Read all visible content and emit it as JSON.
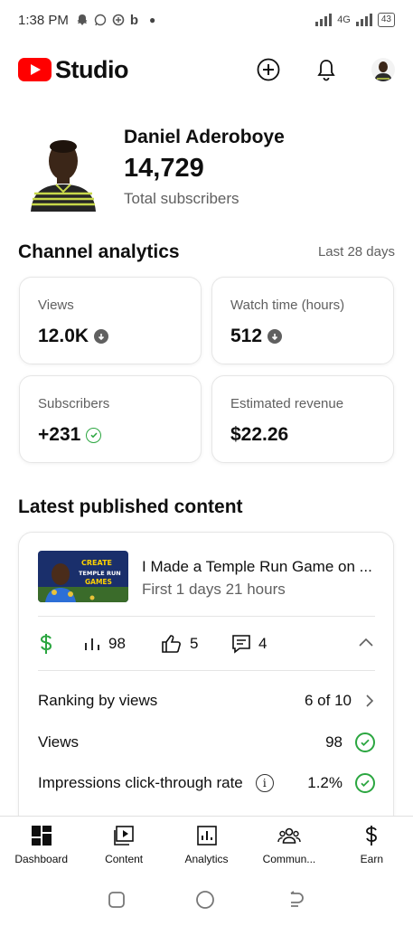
{
  "status_bar": {
    "time": "1:38 PM",
    "network": "4G",
    "battery": "43"
  },
  "app": {
    "logo_text": "Studio",
    "brand_color": "#ff0000"
  },
  "profile": {
    "name": "Daniel Aderoboye",
    "subscriber_count": "14,729",
    "subscriber_label": "Total subscribers"
  },
  "analytics": {
    "title": "Channel analytics",
    "range": "Last 28 days",
    "cards": [
      {
        "label": "Views",
        "value": "12.0K",
        "indicator": "down"
      },
      {
        "label": "Watch time (hours)",
        "value": "512",
        "indicator": "down"
      },
      {
        "label": "Subscribers",
        "value": "+231",
        "indicator": "check"
      },
      {
        "label": "Estimated revenue",
        "value": "$22.26",
        "indicator": "none"
      }
    ]
  },
  "latest": {
    "title": "Latest published content",
    "video_title": "I Made a Temple Run Game on ...",
    "video_age": "First 1 days 21 hours",
    "thumbnail_text": [
      "CREATE",
      "TEMPLE RUN",
      "GAMES"
    ],
    "stats": {
      "views": "98",
      "likes": "5",
      "comments": "4"
    },
    "details": [
      {
        "label": "Ranking by views",
        "value": "6 of 10",
        "icon": "chevron-right-icon"
      },
      {
        "label": "Views",
        "value": "98",
        "icon": "check-circle-icon"
      },
      {
        "label": "Impressions click-through rate",
        "value": "1.2%",
        "icon": "check-circle-icon"
      }
    ]
  },
  "bottom_nav": [
    {
      "label": "Dashboard",
      "icon": "dashboard-icon"
    },
    {
      "label": "Content",
      "icon": "content-icon"
    },
    {
      "label": "Analytics",
      "icon": "analytics-icon"
    },
    {
      "label": "Commun...",
      "icon": "community-icon"
    },
    {
      "label": "Earn",
      "icon": "earn-icon"
    }
  ],
  "colors": {
    "accent_green": "#2ba640",
    "secondary_text": "#606060"
  }
}
